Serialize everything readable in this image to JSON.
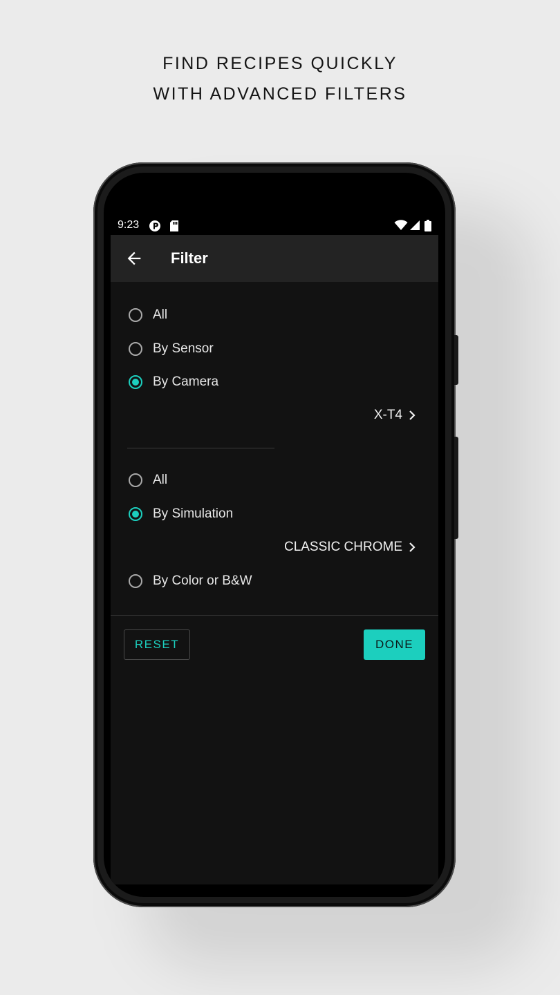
{
  "promo": {
    "line1": "FIND RECIPES QUICKLY",
    "line2": "WITH ADVANCED FILTERS"
  },
  "status_bar": {
    "time": "9:23",
    "left_icons": [
      "app-notification-icon",
      "sd-card-icon"
    ],
    "right_icons": [
      "wifi-icon",
      "cell-signal-icon",
      "battery-icon"
    ]
  },
  "toolbar": {
    "title": "Filter",
    "back_icon": "arrow-left-icon"
  },
  "camera_filter": {
    "options": [
      {
        "label": "All",
        "selected": false
      },
      {
        "label": "By Sensor",
        "selected": false
      },
      {
        "label": "By Camera",
        "selected": true
      }
    ],
    "selected_value": "X-T4"
  },
  "simulation_filter": {
    "options": [
      {
        "label": "All",
        "selected": false
      },
      {
        "label": "By Simulation",
        "selected": true
      },
      {
        "label": "By Color or B&W",
        "selected": false
      }
    ],
    "selected_value": "CLASSIC CHROME"
  },
  "actions": {
    "reset_label": "RESET",
    "done_label": "DONE"
  },
  "colors": {
    "accent": "#1ccfbe",
    "background": "#121212",
    "toolbar": "#232323"
  }
}
